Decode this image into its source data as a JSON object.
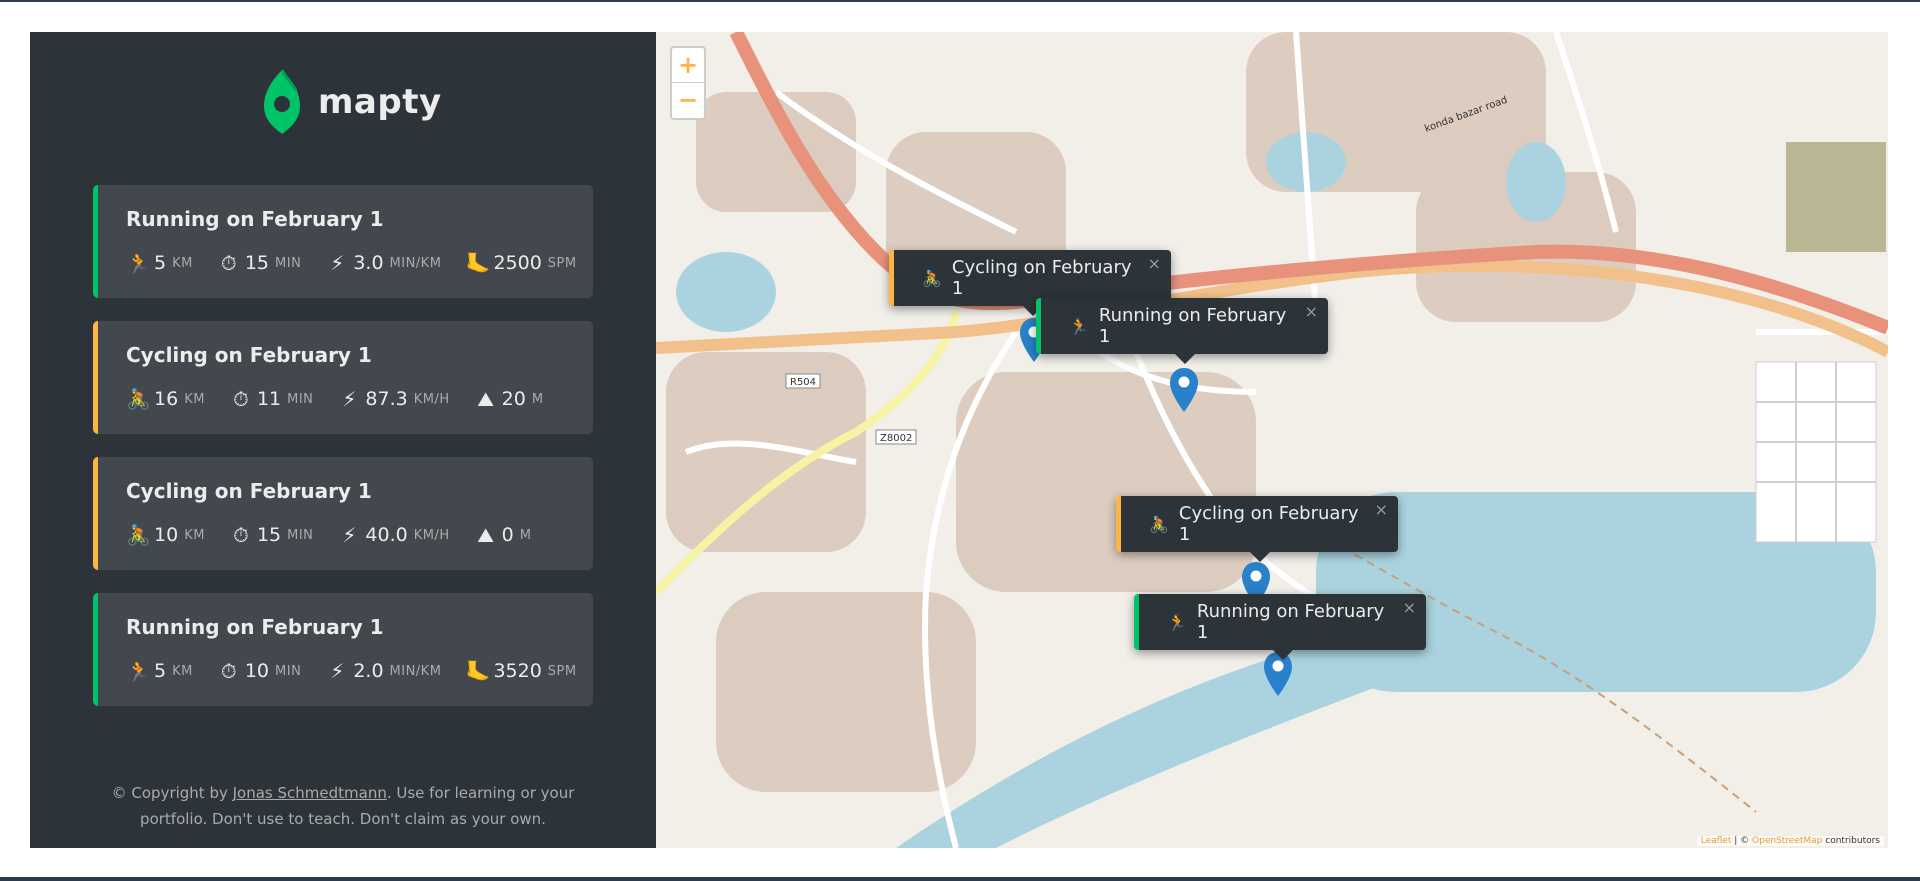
{
  "app": {
    "name": "mapty"
  },
  "workouts": [
    {
      "type": "running",
      "title": "Running on February 1",
      "details": [
        {
          "icon": "🏃",
          "icon_name": "running-icon",
          "value": "5",
          "unit": "km"
        },
        {
          "icon": "⏱",
          "icon_name": "stopwatch-icon",
          "value": "15",
          "unit": "min"
        },
        {
          "icon": "⚡",
          "icon_name": "lightning-icon",
          "value": "3.0",
          "unit": "min/km"
        },
        {
          "icon": "🦶",
          "icon_name": "foot-icon",
          "value": "2500",
          "unit": "spm"
        }
      ]
    },
    {
      "type": "cycling",
      "title": "Cycling on February 1",
      "details": [
        {
          "icon": "🚴",
          "icon_name": "cycling-icon",
          "value": "16",
          "unit": "km"
        },
        {
          "icon": "⏱",
          "icon_name": "stopwatch-icon",
          "value": "11",
          "unit": "min"
        },
        {
          "icon": "⚡",
          "icon_name": "lightning-icon",
          "value": "87.3",
          "unit": "km/h"
        },
        {
          "icon": "⛰",
          "icon_name": "mountain-icon",
          "value": "20",
          "unit": "m"
        }
      ]
    },
    {
      "type": "cycling",
      "title": "Cycling on February 1",
      "details": [
        {
          "icon": "🚴",
          "icon_name": "cycling-icon",
          "value": "10",
          "unit": "km"
        },
        {
          "icon": "⏱",
          "icon_name": "stopwatch-icon",
          "value": "15",
          "unit": "min"
        },
        {
          "icon": "⚡",
          "icon_name": "lightning-icon",
          "value": "40.0",
          "unit": "km/h"
        },
        {
          "icon": "⛰",
          "icon_name": "mountain-icon",
          "value": "0",
          "unit": "m"
        }
      ]
    },
    {
      "type": "running",
      "title": "Running on February 1",
      "details": [
        {
          "icon": "🏃",
          "icon_name": "running-icon",
          "value": "5",
          "unit": "km"
        },
        {
          "icon": "⏱",
          "icon_name": "stopwatch-icon",
          "value": "10",
          "unit": "min"
        },
        {
          "icon": "⚡",
          "icon_name": "lightning-icon",
          "value": "2.0",
          "unit": "min/km"
        },
        {
          "icon": "🦶",
          "icon_name": "foot-icon",
          "value": "3520",
          "unit": "spm"
        }
      ]
    }
  ],
  "copyright": {
    "prefix": "© Copyright by ",
    "author": "Jonas Schmedtmann",
    "suffix": ". Use for learning or your portfolio. Don't use to teach. Don't claim as your own."
  },
  "map": {
    "zoom_in": "+",
    "zoom_out": "−",
    "popups": [
      {
        "type": "cycling",
        "icon": "🚴",
        "label": "Cycling on February 1"
      },
      {
        "type": "running",
        "icon": "🏃",
        "label": "Running on February 1"
      },
      {
        "type": "cycling",
        "icon": "🚴",
        "label": "Cycling on February 1"
      },
      {
        "type": "running",
        "icon": "🏃",
        "label": "Running on February 1"
      }
    ],
    "close_glyph": "×",
    "road_labels": [
      "R504",
      "Z8002",
      "konda bazar road"
    ],
    "attribution": {
      "leaflet": "Leaflet",
      "sep": " | © ",
      "osm": "OpenStreetMap",
      "suffix": " contributors"
    }
  },
  "colors": {
    "running": "#00c46a",
    "cycling": "#ffb545",
    "sidebar_bg": "#2d3439",
    "card_bg": "#42484d",
    "pin_blue": "#2a81cb"
  }
}
